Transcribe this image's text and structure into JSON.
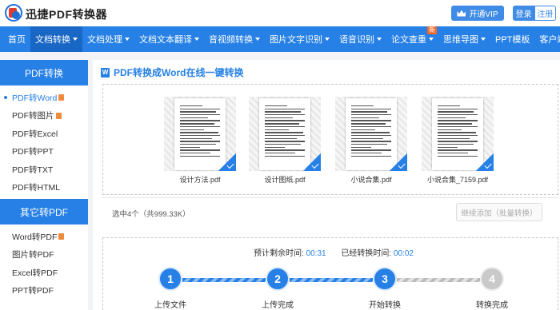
{
  "app": {
    "title": "迅捷PDF转换器"
  },
  "topbar": {
    "vip_label": "开通VIP",
    "login_label": "登录",
    "register_label": "注册"
  },
  "nav": {
    "items": [
      {
        "label": "首页",
        "caret": false
      },
      {
        "label": "文档转换",
        "caret": true,
        "active": true
      },
      {
        "label": "文档处理",
        "caret": true
      },
      {
        "label": "文档文本翻译",
        "caret": true
      },
      {
        "label": "音视频转换",
        "caret": true
      },
      {
        "label": "图片文字识别",
        "caret": true
      },
      {
        "label": "语音识别",
        "caret": true
      },
      {
        "label": "论文查重",
        "caret": true,
        "badge": "新"
      },
      {
        "label": "思维导图",
        "caret": true
      },
      {
        "label": "PPT模板",
        "caret": false
      },
      {
        "label": "客户端",
        "caret": true
      }
    ]
  },
  "sidebar": {
    "group1_title": "PDF转换",
    "group1_items": [
      {
        "label": "PDF转Word",
        "hot": true,
        "active": true
      },
      {
        "label": "PDF转图片",
        "hot": true
      },
      {
        "label": "PDF转Excel"
      },
      {
        "label": "PDF转PPT"
      },
      {
        "label": "PDF转TXT"
      },
      {
        "label": "PDF转HTML"
      }
    ],
    "group2_title": "其它转PDF",
    "group2_items": [
      {
        "label": "Word转PDF",
        "hot": true
      },
      {
        "label": "图片转PDF"
      },
      {
        "label": "Excel转PDF"
      },
      {
        "label": "PPT转PDF"
      }
    ]
  },
  "main": {
    "title": "PDF转换成Word在线一键转换",
    "title_icon": "W",
    "files": [
      {
        "name": "设计方法.pdf"
      },
      {
        "name": "设计图纸.pdf"
      },
      {
        "name": "小说合集.pdf"
      },
      {
        "name": "小说合集_7159.pdf"
      }
    ],
    "selection_info": "选中4个（共999.33K）",
    "add_button": "继续添加（批量转换）",
    "progress": {
      "remaining_label": "预计剩余时间:",
      "remaining_value": "00:31",
      "elapsed_label": "已经转换时间:",
      "elapsed_value": "00:02",
      "steps": [
        {
          "num": "1",
          "label": "上传文件",
          "done": true
        },
        {
          "num": "2",
          "label": "上传完成",
          "done": true
        },
        {
          "num": "3",
          "label": "开始转换",
          "done": true
        },
        {
          "num": "4",
          "label": "转换完成",
          "done": false
        }
      ]
    }
  },
  "colors": {
    "brand": "#2680e6",
    "accent_badge": "#f26a2a"
  }
}
